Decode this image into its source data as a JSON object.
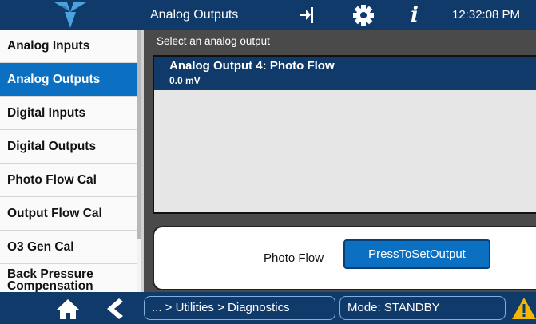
{
  "header": {
    "title": "Analog Outputs",
    "clock": "12:32:08 PM",
    "info_glyph": "i",
    "icons": [
      "teledyne-logo",
      "exit-icon",
      "gear-icon",
      "info-icon"
    ]
  },
  "menu": {
    "items": [
      {
        "label": "Analog Inputs",
        "active": false
      },
      {
        "label": "Analog Outputs",
        "active": true
      },
      {
        "label": "Digital Inputs",
        "active": false
      },
      {
        "label": "Digital Outputs",
        "active": false
      },
      {
        "label": "Photo Flow Cal",
        "active": false
      },
      {
        "label": "Output Flow Cal",
        "active": false
      },
      {
        "label": "O3 Gen Cal",
        "active": false
      },
      {
        "label": "Back Pressure Compensation",
        "active": false
      }
    ]
  },
  "main": {
    "list_header": "Select an analog output",
    "selected_output": {
      "name": "Analog Output 4: Photo Flow",
      "value": "0.0 mV"
    },
    "panel": {
      "label": "Photo Flow",
      "button_label": "PressToSetOutput"
    }
  },
  "footer": {
    "breadcrumb": "... > Utilities > Diagnostics",
    "mode": "Mode: STANDBY",
    "icons": [
      "home-icon",
      "back-icon",
      "warning-icon"
    ]
  },
  "colors": {
    "header_bg": "#0f3a69",
    "active_item": "#0b70c2",
    "content_bg": "#4a4a4a",
    "warning": "#f2b705"
  }
}
